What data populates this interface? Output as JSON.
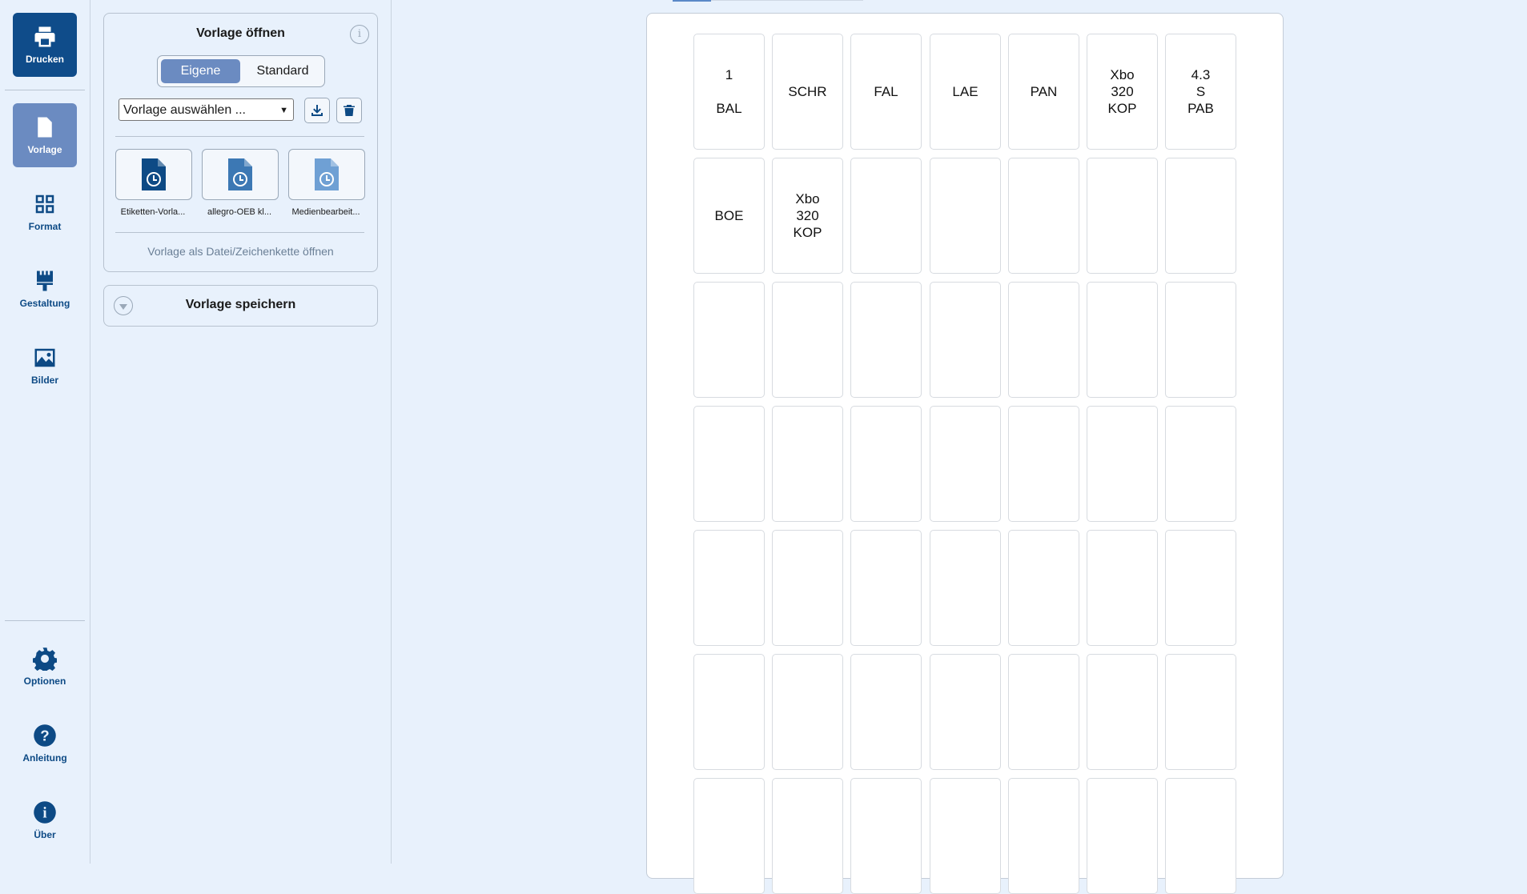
{
  "nav": {
    "top": [
      {
        "id": "drucken",
        "label": "Drucken",
        "icon": "printer-icon"
      },
      {
        "id": "vorlage",
        "label": "Vorlage",
        "icon": "file-icon"
      },
      {
        "id": "format",
        "label": "Format",
        "icon": "grid-icon"
      },
      {
        "id": "gestaltung",
        "label": "Gestaltung",
        "icon": "brush-icon"
      },
      {
        "id": "bilder",
        "label": "Bilder",
        "icon": "image-icon"
      }
    ],
    "bottom": [
      {
        "id": "optionen",
        "label": "Optionen",
        "icon": "gear-icon"
      },
      {
        "id": "anleitung",
        "label": "Anleitung",
        "icon": "help-icon"
      },
      {
        "id": "ueber",
        "label": "Über",
        "icon": "info-icon"
      }
    ],
    "active": "vorlage"
  },
  "open_template": {
    "title": "Vorlage öffnen",
    "toggle": {
      "selected": "Eigene",
      "other": "Standard"
    },
    "select_placeholder": "Vorlage auswählen ...",
    "recent": [
      {
        "label": "Etiketten-Vorla...",
        "color": "#0d4a85"
      },
      {
        "label": "allegro-OEB kl...",
        "color": "#3c78b4"
      },
      {
        "label": "Medienbearbeit...",
        "color": "#6fa0d4"
      }
    ],
    "open_as_file_link": "Vorlage als Datei/Zeichenkette öffnen"
  },
  "save_template": {
    "title": "Vorlage speichern"
  },
  "sheet": {
    "columns": 7,
    "rows": [
      [
        "1\n\nBAL",
        "SCHR",
        "FAL",
        "LAE",
        "PAN",
        "Xbo\n320\nKOP",
        "4.3\nS\nPAB"
      ],
      [
        "BOE",
        "Xbo\n320\nKOP",
        "",
        "",
        "",
        "",
        ""
      ],
      [
        "",
        "",
        "",
        "",
        "",
        "",
        ""
      ],
      [
        "",
        "",
        "",
        "",
        "",
        "",
        ""
      ],
      [
        "",
        "",
        "",
        "",
        "",
        "",
        ""
      ],
      [
        "",
        "",
        "",
        "",
        "",
        "",
        ""
      ],
      [
        "",
        "",
        "",
        "",
        "",
        "",
        ""
      ]
    ]
  }
}
